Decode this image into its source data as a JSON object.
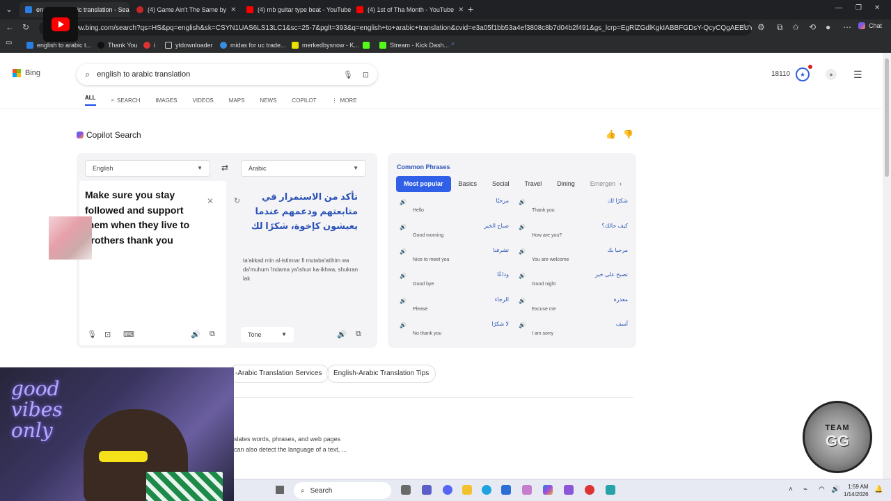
{
  "browser": {
    "tabs": [
      {
        "title": "english to arabic translation - Search",
        "active": true
      },
      {
        "title": "(4) Game Ain't The Same by",
        "active": false
      },
      {
        "title": "(4) rnb guitar type beat - YouTube",
        "active": false
      },
      {
        "title": "(4) 1st of Tha Month - YouTube",
        "active": false
      }
    ],
    "url": "ww.bing.com/search?qs=HS&pq=english&sk=CSYN1UAS6LS13LC1&sc=25-7&pglt=393&q=english+to+arabic+translation&cvid=e3a05f1bb53a4ef3808c8b7d04b2f491&gs_lcrp=EgRlZGdlKgkIABBFGDsY-QcyCQgAEEUYOxj5BzIG...",
    "chat_label": "Chat",
    "bookmarks": [
      "english to arabic t...",
      "Thank You",
      "i",
      "ytdownloader",
      "midas for uc trade...",
      "merkedbysnow - K...",
      "",
      "Stream - Kick Dash..."
    ]
  },
  "bing": {
    "logo_text": "Bing",
    "query": "english to arabic translation",
    "nav_tabs": [
      "ALL",
      "SEARCH",
      "IMAGES",
      "VIDEOS",
      "MAPS",
      "NEWS",
      "COPILOT",
      "MORE"
    ],
    "rewards_points": "18110",
    "copilot_search_label": "Copilot Search"
  },
  "translator": {
    "source_lang": "English",
    "target_lang": "Arabic",
    "source_text": "Make sure you stay followed and support them when they live to brothers thank you",
    "target_text": "تأكد من الاستمرار في متابعتهم ودعمهم عندما يعيشون كإخوة، شكرًا لك",
    "transliteration": "ta'akkad min al-istimrar fi mutaba'atihim wa da'muhum 'indama ya'ishun ka-ikhwa, shukran lak",
    "tone_label": "Tone"
  },
  "phrases": {
    "title": "Common Phrases",
    "tabs": [
      "Most popular",
      "Basics",
      "Social",
      "Travel",
      "Dining",
      "Emergen"
    ],
    "items": [
      {
        "ar": "مرحبًا",
        "en": "Hello"
      },
      {
        "ar": "شكرًا لك",
        "en": "Thank you"
      },
      {
        "ar": "صباح الخير",
        "en": "Good morning"
      },
      {
        "ar": "كيف حالك؟",
        "en": "How are you?"
      },
      {
        "ar": "تشرفنا",
        "en": "Nice to meet you"
      },
      {
        "ar": "مرحبا بك",
        "en": "You are welcome"
      },
      {
        "ar": "وداعًا",
        "en": "Good bye"
      },
      {
        "ar": "تصبح على خير",
        "en": "Good night"
      },
      {
        "ar": "الرجاء",
        "en": "Please"
      },
      {
        "ar": "معذرة",
        "en": "Excuse me"
      },
      {
        "ar": "لا شكرًا",
        "en": "No thank you"
      },
      {
        "ar": "آسف",
        "en": "I am sorry"
      }
    ]
  },
  "related": {
    "chips": [
      "-Arabic Translation Services",
      "English-Arabic Translation Tips"
    ],
    "snippet_1": "slates words, phrases, and web pages",
    "snippet_2": "can also detect the language of a text, ..."
  },
  "overlays": {
    "webcam_text": "good vibes only",
    "badge_top": "TEAM",
    "badge_main": "GG"
  },
  "taskbar": {
    "search_label": "Search",
    "time": "1:59 AM",
    "date": "1/14/2026"
  },
  "colors": {
    "accent": "#3060e8",
    "link": "#2a52b8",
    "chrome_bg": "#202124"
  }
}
